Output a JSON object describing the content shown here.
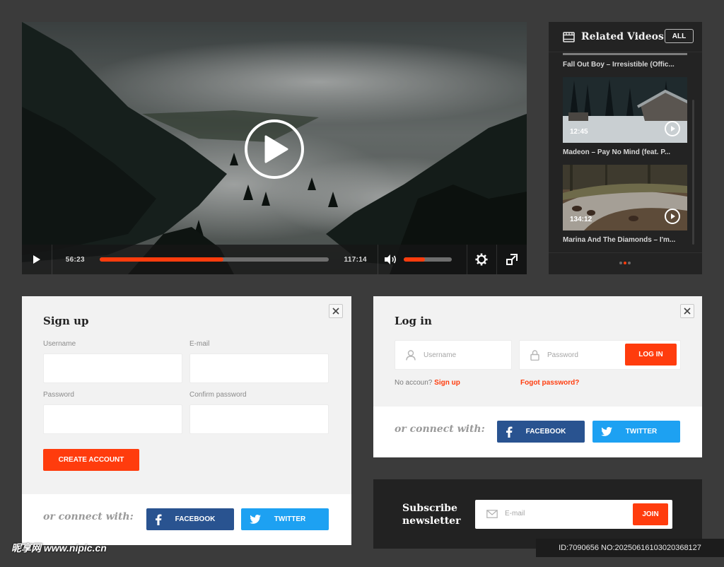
{
  "player": {
    "current_time": "56:23",
    "total_time": "117:14",
    "progress": 0.54,
    "volume": 0.45,
    "accent_color": "#ff3c0d"
  },
  "related": {
    "title": "Related Videos",
    "all_label": "ALL",
    "items": [
      {
        "caption": "Fall Out Boy – Irresistible (Offic..."
      },
      {
        "caption": "Madeon – Pay No Mind (feat. P...",
        "duration": "12:45"
      },
      {
        "caption": "Marina And The Diamonds – I'm...",
        "duration": "134:12"
      }
    ],
    "pager_active": 1
  },
  "signup": {
    "title": "Sign up",
    "username_label": "Username",
    "email_label": "E-mail",
    "password_label": "Password",
    "confirm_label": "Confirm password",
    "create_label": "CREATE ACCOUNT",
    "connect_label": "or connect with:",
    "facebook_label": "FACEBOOK",
    "twitter_label": "TWITTER"
  },
  "login": {
    "title": "Log in",
    "username_placeholder": "Username",
    "password_placeholder": "Password",
    "login_label": "LOG IN",
    "no_account_text": "No accoun?",
    "signup_link": "Sign up",
    "forgot_link": "Fogot password?",
    "connect_label": "or connect with:",
    "facebook_label": "FACEBOOK",
    "twitter_label": "TWITTER"
  },
  "newsletter": {
    "title_line1": "Subscribe",
    "title_line2": "newsletter",
    "email_placeholder": "E-mail",
    "join_label": "JOIN"
  },
  "watermark": {
    "left": "昵享网 www.nipic.cn",
    "right": "ID:7090656 NO:20250616103020368127"
  },
  "icons": [
    "play-icon",
    "volume-icon",
    "gear-icon",
    "fullscreen-icon",
    "film-icon",
    "close-icon",
    "user-icon",
    "lock-icon",
    "facebook-icon",
    "twitter-icon",
    "mail-icon"
  ]
}
